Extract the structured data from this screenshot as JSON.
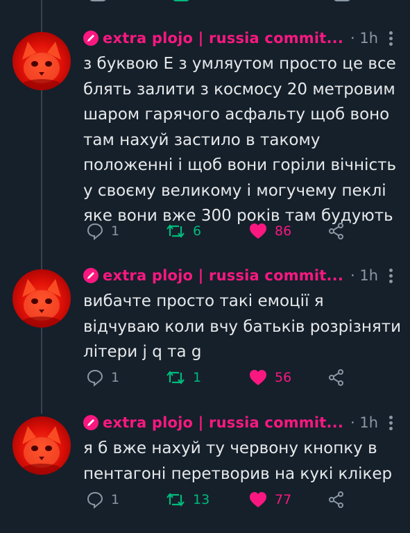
{
  "tweets": [
    {
      "author": "extra plojo | russia commit...",
      "time": "· 1h",
      "text": "з буквою Е з умляутом просто це все блять залити з космосу 20 метровим шаром гарячого асфальту щоб воно там нахуй застило в такому положенні і щоб вони горіли вічність у своєму великому і могучему пеклі яке вони вже 300 років там будують",
      "replies": "1",
      "retweets": "6",
      "likes": "86"
    },
    {
      "author": "extra plojo | russia commit...",
      "time": "· 1h",
      "text": "вибачте  просто такі емоції я відчуваю коли вчу батьків розрізняти літери j q та g",
      "replies": "1",
      "retweets": "1",
      "likes": "56"
    },
    {
      "author": "extra plojo | russia commit...",
      "time": "· 1h",
      "text": "я б вже нахуй ту червону кнопку в пентагоні перетворив на кукі клікер",
      "replies": "1",
      "retweets": "13",
      "likes": "77"
    }
  ],
  "icons": {
    "badge": "pen-icon",
    "reply": "reply-icon",
    "retweet": "retweet-icon",
    "like": "heart-icon",
    "share": "share-icon",
    "more": "more-vertical-icon"
  },
  "colors": {
    "background": "#15202b",
    "name": "#f91880",
    "retweet": "#00ba7c",
    "like": "#f91880",
    "muted": "#8b98a5"
  }
}
